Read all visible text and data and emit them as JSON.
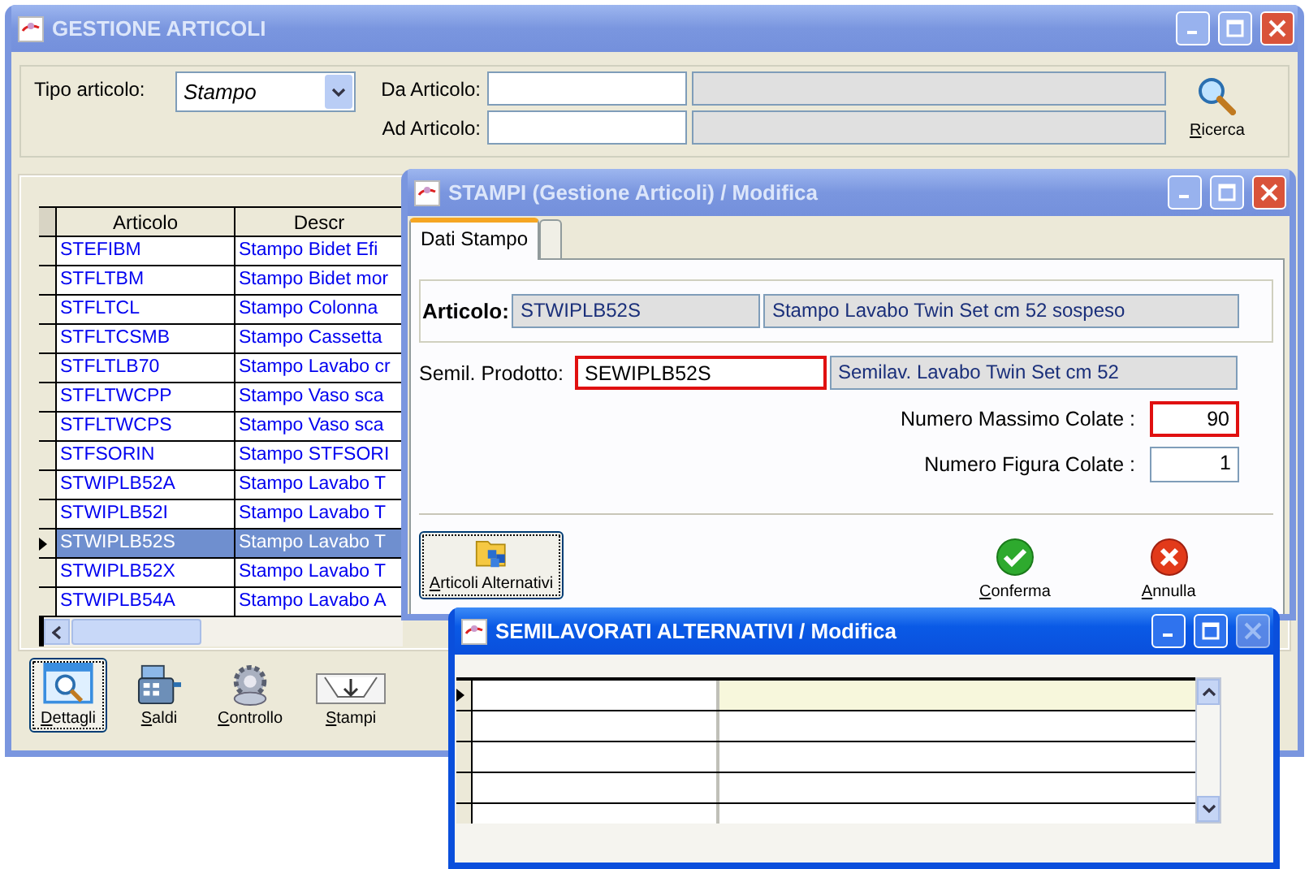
{
  "main_window": {
    "title": "GESTIONE ARTICOLI",
    "active": false,
    "filters": {
      "type_label": "Tipo articolo:",
      "type_value": "Stampo",
      "from_label": "Da Articolo:",
      "to_label": "Ad Articolo:",
      "search_button": "Ricerca"
    },
    "table": {
      "columns": [
        "Articolo",
        "Descr"
      ],
      "rows": [
        {
          "cells": [
            "STEFIBM",
            "Stampo Bidet Efi"
          ],
          "selected": false
        },
        {
          "cells": [
            "STFLTBM",
            "Stampo Bidet mor"
          ],
          "selected": false
        },
        {
          "cells": [
            "STFLTCL",
            "Stampo Colonna"
          ],
          "selected": false
        },
        {
          "cells": [
            "STFLTCSMB",
            "Stampo Cassetta"
          ],
          "selected": false
        },
        {
          "cells": [
            "STFLTLB70",
            "Stampo Lavabo cr"
          ],
          "selected": false
        },
        {
          "cells": [
            "STFLTWCPP",
            "Stampo Vaso sca"
          ],
          "selected": false
        },
        {
          "cells": [
            "STFLTWCPS",
            "Stampo Vaso sca"
          ],
          "selected": false
        },
        {
          "cells": [
            "STFSORIN",
            "Stampo STFSORI"
          ],
          "selected": false
        },
        {
          "cells": [
            "STWIPLB52A",
            "Stampo Lavabo T"
          ],
          "selected": false
        },
        {
          "cells": [
            "STWIPLB52I",
            "Stampo Lavabo T"
          ],
          "selected": false
        },
        {
          "cells": [
            "STWIPLB52S",
            "Stampo Lavabo T"
          ],
          "selected": true
        },
        {
          "cells": [
            "STWIPLB52X",
            "Stampo Lavabo T"
          ],
          "selected": false
        },
        {
          "cells": [
            "STWIPLB54A",
            "Stampo Lavabo A"
          ],
          "selected": false
        }
      ]
    },
    "toolbar": [
      {
        "label": "Dettagli",
        "kind": "details",
        "selected": true
      },
      {
        "label": "Saldi",
        "kind": "balances",
        "selected": false
      },
      {
        "label": "Controllo",
        "kind": "control",
        "selected": false
      },
      {
        "label": "Stampi",
        "kind": "molds",
        "selected": false
      }
    ]
  },
  "stampi_dialog": {
    "title": "STAMPI (Gestione Articoli) / Modifica",
    "active": false,
    "tabs": [
      {
        "label": "Dati Stampo",
        "selected": true
      },
      {
        "selected": false
      }
    ],
    "article_label": "Articolo:",
    "article_code": "STWIPLB52S",
    "article_desc": "Stampo Lavabo Twin Set cm 52 sospeso",
    "semi_label": "Semil. Prodotto:",
    "semi_code": {
      "value": "SEWIPLB52S",
      "flagged": true
    },
    "semi_desc": "Semilav. Lavabo Twin Set cm 52",
    "numbers": [
      {
        "label": "Numero Massimo Colate :",
        "value": "90",
        "flagged": true
      },
      {
        "label": "Numero Figura Colate :",
        "value": "1",
        "flagged": false
      }
    ],
    "buttons": [
      {
        "label": "Articoli Alternativi",
        "kind": "alternatives"
      },
      {
        "label": "Conferma",
        "kind": "confirm"
      },
      {
        "label": "Annulla",
        "kind": "cancel"
      }
    ]
  },
  "alt_window": {
    "title": "SEMILAVORATI ALTERNATIVI / Modifica",
    "active": true,
    "close_disabled": true
  }
}
